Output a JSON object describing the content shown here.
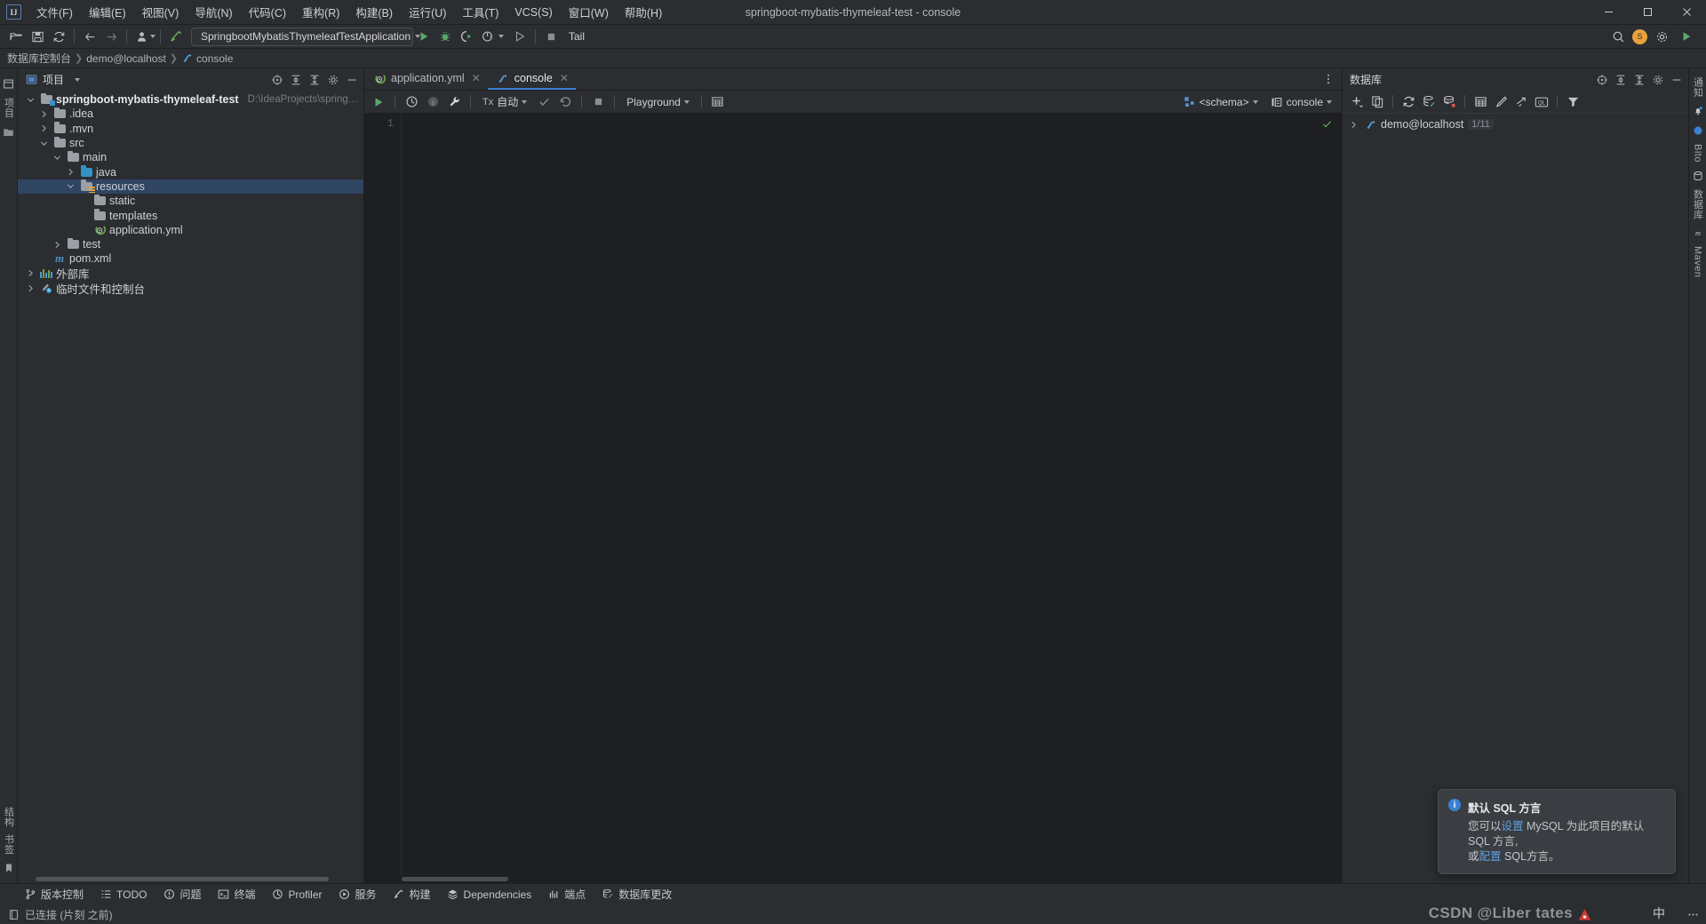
{
  "window": {
    "title": "springboot-mybatis-thymeleaf-test - console",
    "minimize": "—",
    "maximize": "❐",
    "close": "✕"
  },
  "menu": {
    "items": [
      {
        "label": "文件(F)",
        "name": "menu-file"
      },
      {
        "label": "编辑(E)",
        "name": "menu-edit"
      },
      {
        "label": "视图(V)",
        "name": "menu-view"
      },
      {
        "label": "导航(N)",
        "name": "menu-navigate"
      },
      {
        "label": "代码(C)",
        "name": "menu-code"
      },
      {
        "label": "重构(R)",
        "name": "menu-refactor"
      },
      {
        "label": "构建(B)",
        "name": "menu-build"
      },
      {
        "label": "运行(U)",
        "name": "menu-run"
      },
      {
        "label": "工具(T)",
        "name": "menu-tools"
      },
      {
        "label": "VCS(S)",
        "name": "menu-vcs"
      },
      {
        "label": "窗口(W)",
        "name": "menu-window"
      },
      {
        "label": "帮助(H)",
        "name": "menu-help"
      }
    ]
  },
  "toolbar": {
    "run_configuration": "SpringbootMybatisThymeleafTestApplication",
    "tail_label": "Tail",
    "avatar_initial": "S"
  },
  "breadcrumb": {
    "items": [
      "数据库控制台",
      "demo@localhost",
      "console"
    ]
  },
  "left_rail": {
    "top_label": "项目",
    "bottom_labels": [
      "结构",
      "书签"
    ]
  },
  "right_rail": {
    "labels": [
      "通知",
      "Bito",
      "数据库",
      "Maven"
    ]
  },
  "project_panel": {
    "title": "项目",
    "tree": [
      {
        "indent": 0,
        "arrow": "down",
        "icon": "module-folder",
        "label": "springboot-mybatis-thymeleaf-test",
        "bold": true,
        "path": "D:\\IdeaProjects\\springboot-mybatis-",
        "selected": false
      },
      {
        "indent": 1,
        "arrow": "right",
        "icon": "folder",
        "label": ".idea",
        "bold": false,
        "path": "",
        "selected": false
      },
      {
        "indent": 1,
        "arrow": "right",
        "icon": "folder",
        "label": ".mvn",
        "bold": false,
        "path": "",
        "selected": false
      },
      {
        "indent": 1,
        "arrow": "down",
        "icon": "folder",
        "label": "src",
        "bold": false,
        "path": "",
        "selected": false
      },
      {
        "indent": 2,
        "arrow": "down",
        "icon": "folder",
        "label": "main",
        "bold": false,
        "path": "",
        "selected": false
      },
      {
        "indent": 3,
        "arrow": "right",
        "icon": "source-folder",
        "label": "java",
        "bold": false,
        "path": "",
        "selected": false
      },
      {
        "indent": 3,
        "arrow": "down",
        "icon": "resource-folder",
        "label": "resources",
        "bold": false,
        "path": "",
        "selected": true
      },
      {
        "indent": 4,
        "arrow": "none",
        "icon": "folder",
        "label": "static",
        "bold": false,
        "path": "",
        "selected": false
      },
      {
        "indent": 4,
        "arrow": "none",
        "icon": "folder",
        "label": "templates",
        "bold": false,
        "path": "",
        "selected": false
      },
      {
        "indent": 4,
        "arrow": "none",
        "icon": "spring-yaml-file",
        "label": "application.yml",
        "bold": false,
        "path": "",
        "selected": false
      },
      {
        "indent": 2,
        "arrow": "right",
        "icon": "folder",
        "label": "test",
        "bold": false,
        "path": "",
        "selected": false
      },
      {
        "indent": 1,
        "arrow": "none",
        "icon": "maven-file",
        "label": "pom.xml",
        "bold": false,
        "path": "",
        "selected": false
      },
      {
        "indent": 0,
        "arrow": "right",
        "icon": "external-libraries",
        "label": "外部库",
        "bold": false,
        "path": "",
        "selected": false
      },
      {
        "indent": 0,
        "arrow": "right",
        "icon": "scratches",
        "label": "临时文件和控制台",
        "bold": false,
        "path": "",
        "selected": false
      }
    ]
  },
  "editor": {
    "tabs": [
      {
        "label": "application.yml",
        "icon": "spring-yaml-file",
        "active": false
      },
      {
        "label": "console",
        "icon": "console-file",
        "active": true
      }
    ],
    "gutter_lines": [
      "1"
    ],
    "content": ""
  },
  "console_toolbar": {
    "tx_label": "Tx",
    "tx_mode": "自动",
    "playground_label": "Playground",
    "schema_label": "<schema>",
    "session_label": "console"
  },
  "database_panel": {
    "title": "数据库",
    "nodes": [
      {
        "label": "demo@localhost",
        "count": "1/11"
      }
    ]
  },
  "notification": {
    "title": "默认 SQL 方言",
    "line1_prefix": "您可以",
    "line1_link": "设置",
    "line1_mid": " MySQL ",
    "line1_suffix": "为此项目的默认 SQL 方言,",
    "line2_prefix": "或",
    "line2_link": "配置",
    "line2_suffix": " SQL方言。"
  },
  "tool_window_bar": {
    "items": [
      {
        "label": "版本控制",
        "icon": "branch-icon",
        "name": "toolwindow-version-control"
      },
      {
        "label": "TODO",
        "icon": "todo-icon",
        "name": "toolwindow-todo"
      },
      {
        "label": "问题",
        "icon": "problems-icon",
        "name": "toolwindow-problems"
      },
      {
        "label": "终端",
        "icon": "terminal-icon",
        "name": "toolwindow-terminal"
      },
      {
        "label": "Profiler",
        "icon": "profiler-icon",
        "name": "toolwindow-profiler"
      },
      {
        "label": "服务",
        "icon": "services-icon",
        "name": "toolwindow-services"
      },
      {
        "label": "构建",
        "icon": "build-icon",
        "name": "toolwindow-build"
      },
      {
        "label": "Dependencies",
        "icon": "dependencies-icon",
        "name": "toolwindow-dependencies"
      },
      {
        "label": "端点",
        "icon": "endpoints-icon",
        "name": "toolwindow-endpoints"
      },
      {
        "label": "数据库更改",
        "icon": "db-changes-icon",
        "name": "toolwindow-database-changes"
      }
    ]
  },
  "status_bar": {
    "connection": "已连接 (片刻 之前)",
    "watermark": "CSDN @Liber tates",
    "ime": "中"
  },
  "colors": {
    "accent_blue": "#3b82d4",
    "selection_blue": "#2f4562",
    "green_run": "#59a869",
    "panel_bg": "#2b2d30",
    "editor_bg": "#1e1f22",
    "text": "#dfe1e5"
  }
}
